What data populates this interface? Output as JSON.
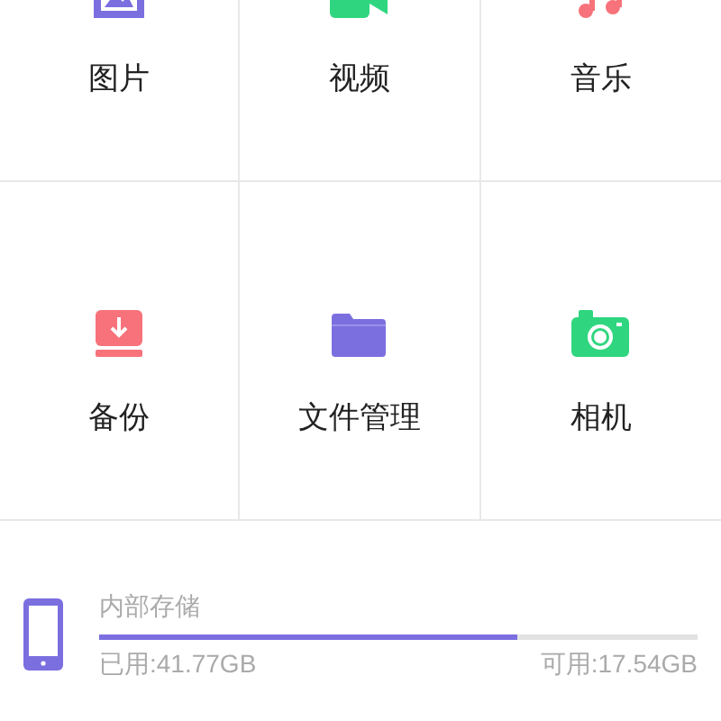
{
  "grid": [
    {
      "kind": "picture",
      "label": "图片"
    },
    {
      "kind": "video",
      "label": "视频"
    },
    {
      "kind": "music",
      "label": "音乐"
    },
    {
      "kind": "backup",
      "label": "备份"
    },
    {
      "kind": "folder",
      "label": "文件管理"
    },
    {
      "kind": "camera",
      "label": "相机"
    }
  ],
  "storage": {
    "title": "内部存储",
    "level": 0.7,
    "used": "已用:41.77GB",
    "free": "可用:17.54GB"
  }
}
